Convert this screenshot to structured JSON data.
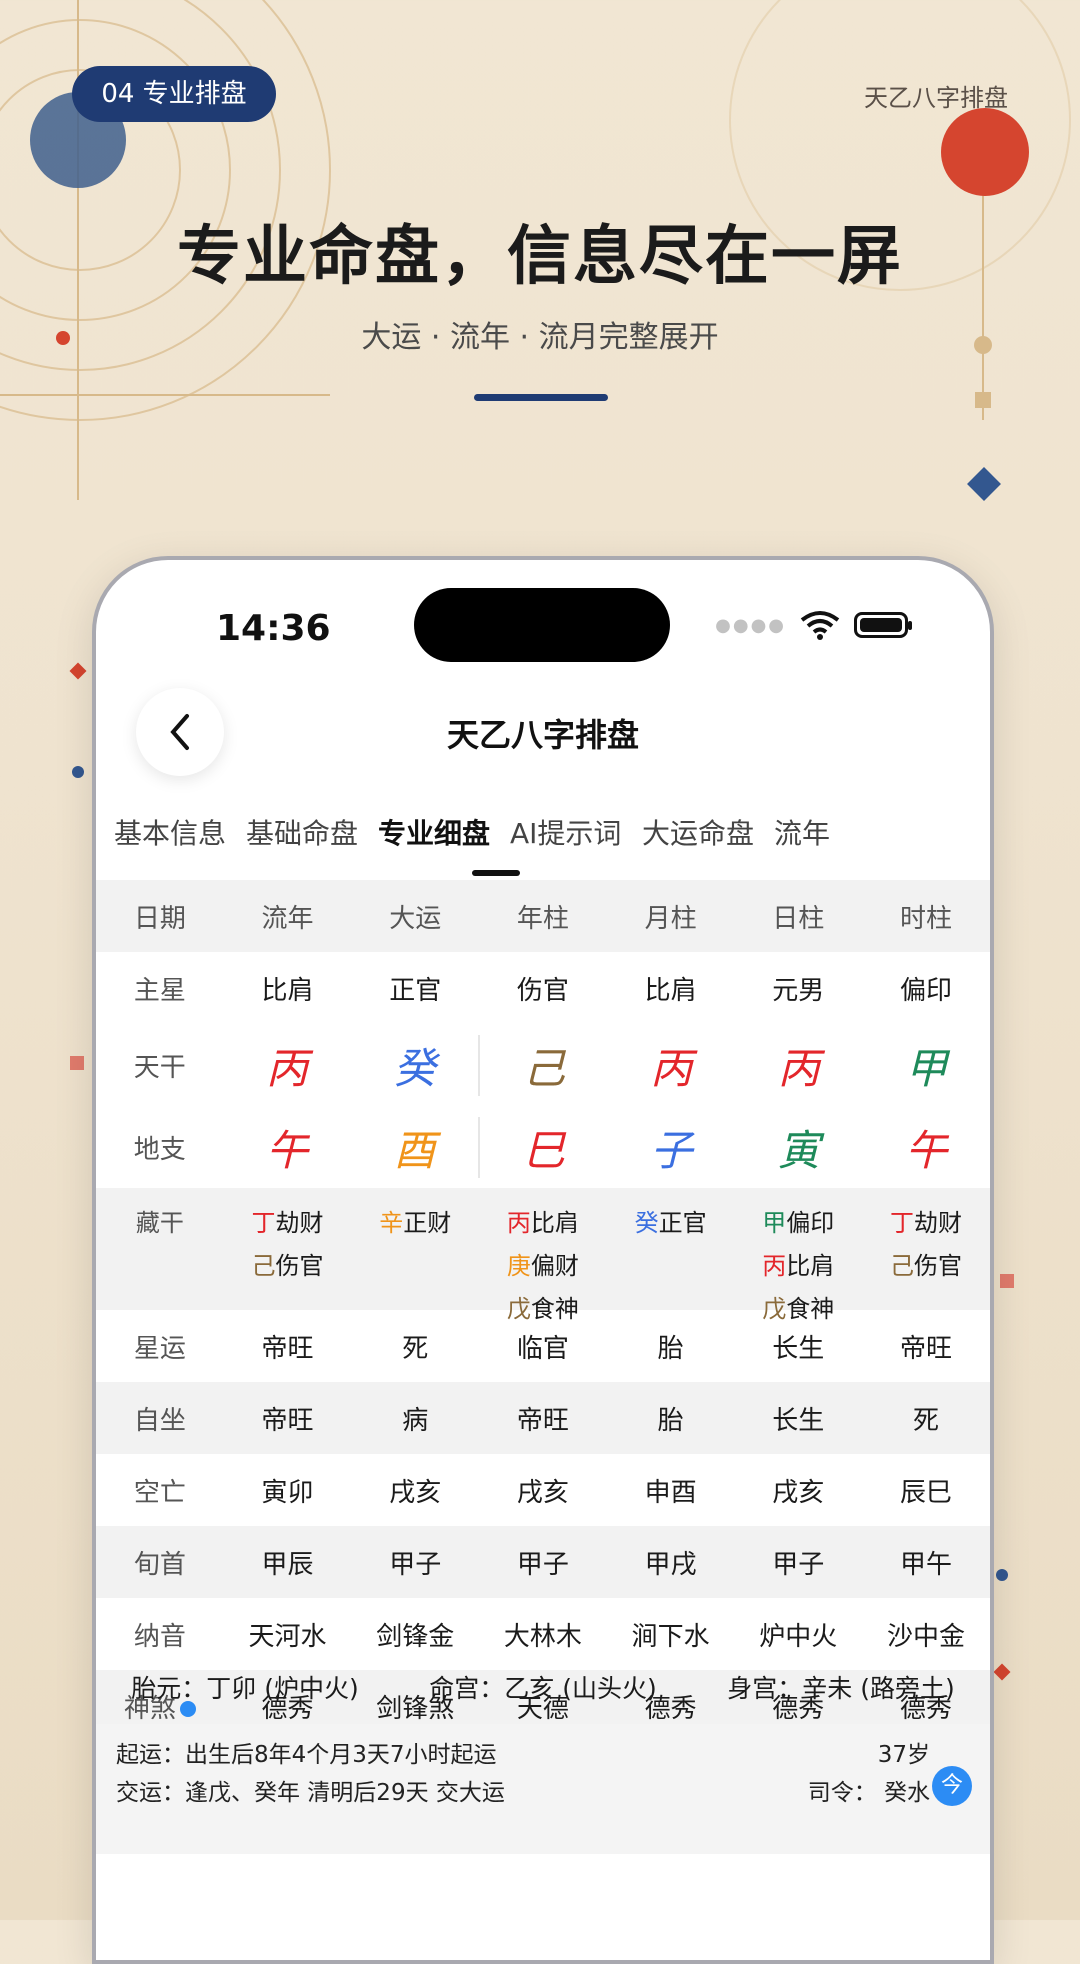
{
  "promo": {
    "badge": "04  专业排盘",
    "brand": "天乙八字排盘",
    "headline": "专业命盘，信息尽在一屏",
    "subline": "大运 ·  流年 ·  流月完整展开"
  },
  "colors": {
    "navy": "#1f3b73",
    "red": "#e3262b",
    "blue": "#3b6fe0",
    "green": "#1e8a5a",
    "orange": "#f0941a",
    "brown": "#8a6a3a",
    "accent_blue": "#2c8cf4"
  },
  "status_bar": {
    "time": "14:36",
    "icons": [
      "signal-dots-icon",
      "wifi-icon",
      "battery-icon"
    ]
  },
  "nav": {
    "title": "天乙八字排盘",
    "back_icon": "chevron-left-icon"
  },
  "tabs": [
    {
      "label": "基本信息"
    },
    {
      "label": "基础命盘"
    },
    {
      "label": "专业细盘",
      "active": true
    },
    {
      "label": "AI提示词"
    },
    {
      "label": "大运命盘"
    },
    {
      "label": "流年"
    }
  ],
  "table": {
    "header": [
      "日期",
      "流年",
      "大运",
      "年柱",
      "月柱",
      "日柱",
      "时柱"
    ],
    "zhuxing": {
      "label": "主星",
      "values": [
        "比肩",
        "正官",
        "伤官",
        "比肩",
        "元男",
        "偏印"
      ]
    },
    "tiangan": {
      "label": "天干",
      "values": [
        "丙",
        "癸",
        "己",
        "丙",
        "丙",
        "甲"
      ],
      "colors": [
        "red",
        "blue",
        "brown",
        "red",
        "red",
        "green"
      ]
    },
    "dizhi": {
      "label": "地支",
      "values": [
        "午",
        "酉",
        "巳",
        "子",
        "寅",
        "午"
      ],
      "colors": [
        "red",
        "orange",
        "red",
        "blue",
        "green",
        "red"
      ]
    },
    "canggan": {
      "label": "藏干",
      "columns": [
        [
          {
            "gan": "丁",
            "god": "劫财",
            "color": "red"
          },
          {
            "gan": "己",
            "god": "伤官",
            "color": "brown"
          }
        ],
        [
          {
            "gan": "辛",
            "god": "正财",
            "color": "orange"
          }
        ],
        [
          {
            "gan": "丙",
            "god": "比肩",
            "color": "red"
          },
          {
            "gan": "庚",
            "god": "偏财",
            "color": "orange"
          },
          {
            "gan": "戊",
            "god": "食神",
            "color": "brown"
          }
        ],
        [
          {
            "gan": "癸",
            "god": "正官",
            "color": "blue"
          }
        ],
        [
          {
            "gan": "甲",
            "god": "偏印",
            "color": "green"
          },
          {
            "gan": "丙",
            "god": "比肩",
            "color": "red"
          },
          {
            "gan": "戊",
            "god": "食神",
            "color": "brown"
          }
        ],
        [
          {
            "gan": "丁",
            "god": "劫财",
            "color": "red"
          },
          {
            "gan": "己",
            "god": "伤官",
            "color": "brown"
          }
        ]
      ]
    },
    "rows": [
      {
        "label": "星运",
        "values": [
          "帝旺",
          "死",
          "临官",
          "胎",
          "长生",
          "帝旺"
        ]
      },
      {
        "label": "自坐",
        "values": [
          "帝旺",
          "病",
          "帝旺",
          "胎",
          "长生",
          "死"
        ]
      },
      {
        "label": "空亡",
        "values": [
          "寅卯",
          "戌亥",
          "戌亥",
          "申酉",
          "戌亥",
          "辰巳"
        ]
      },
      {
        "label": "旬首",
        "values": [
          "甲辰",
          "甲子",
          "甲子",
          "甲戌",
          "甲子",
          "甲午"
        ]
      },
      {
        "label": "纳音",
        "values": [
          "天河水",
          "剑锋金",
          "大林木",
          "涧下水",
          "炉中火",
          "沙中金"
        ]
      },
      {
        "label": "神煞",
        "values": [
          "德秀",
          "剑锋煞",
          "天德",
          "德秀",
          "德秀",
          "德秀"
        ],
        "icon": "info-dot-icon"
      }
    ]
  },
  "info": {
    "taiyuan": "胎元：丁卯 (炉中火)",
    "minggong": "命宫：乙亥 (山头火)",
    "shengong": "身宫：辛未 (路旁土)",
    "qiyun": "起运：出生后8年4个月3天7小时起运",
    "jiaoyun": "交运：逢戊、癸年 清明后29天 交大运",
    "age": "37岁",
    "siling": "司令：  癸水",
    "today_button": "今"
  }
}
